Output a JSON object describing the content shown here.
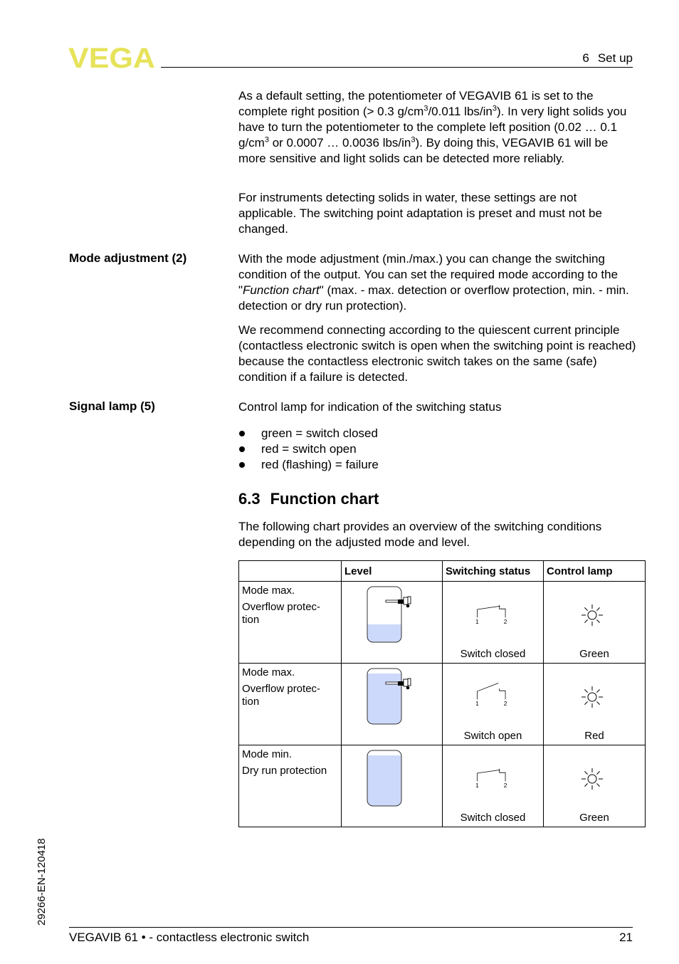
{
  "header": {
    "logo_text": "VEGA",
    "logo_color": "#e6e35a",
    "section_number": "6",
    "section_title": "Set up"
  },
  "intro": {
    "p1": {
      "t1": "As a default setting, the potentiometer of VEGAVIB 61 is set to the complete right position (> 0.3 g/cm",
      "s1": "3",
      "t2": "/0.011 lbs/in",
      "s2": "3",
      "t3": "). In very light solids you have to turn the potentiometer to the complete left position (0.02 … 0.1 g/cm",
      "s3": "3",
      "t4": " or 0.0007 … 0.0036 lbs/in",
      "s4": "3",
      "t5": "). By doing this, VEGAVIB 61 will be more sensitive and light solids can be detected more reliably."
    },
    "p2": "For instruments detecting solids in water, these settings are not applicable. The switching point adaptation is preset and must not be changed."
  },
  "mode_adjustment": {
    "label": "Mode adjustment (2)",
    "p1_a": "With the mode adjustment (min./max.) you can change the switching condition of the output. You can set the required mode according to the \"",
    "p1_em": "Function chart",
    "p1_b": "\" (max. - max. detection or overflow protection, min. - min. detection or dry run protection).",
    "p2": "We recommend connecting according to the quiescent current principle (contactless electronic switch is open when the switching point is reached) because the contactless electronic switch takes on the same (safe) condition if a failure is detected."
  },
  "signal_lamp": {
    "label": "Signal lamp (5)",
    "text": "Control lamp for indication of the switching status",
    "bullets": [
      "green = switch closed",
      "red = switch open",
      "red (flashing) = failure"
    ]
  },
  "section": {
    "number": "6.3",
    "title": "Function chart",
    "intro": "The following chart provides an overview of the switching conditions depending on the adjusted mode and level."
  },
  "table": {
    "headers": [
      "",
      "Level",
      "Switching status",
      "Control lamp"
    ],
    "liquid_color": "#cdd9fa",
    "rows": [
      {
        "mode": "Mode max.",
        "description": "Overflow protec-tion",
        "desc_line1": "Overflow protec-",
        "desc_line2": "tion",
        "level": "low",
        "sensor_position": "top",
        "switch_state": "closed",
        "switch_label": "Switch closed",
        "terminal_1": "1",
        "terminal_2": "2",
        "lamp": "Green"
      },
      {
        "mode": "Mode max.",
        "description": "Overflow protec-tion",
        "desc_line1": "Overflow protec-",
        "desc_line2": "tion",
        "level": "high",
        "sensor_position": "top",
        "switch_state": "open",
        "switch_label": "Switch open",
        "terminal_1": "1",
        "terminal_2": "2",
        "lamp": "Red"
      },
      {
        "mode": "Mode min.",
        "description": "Dry run protection",
        "desc_line1": "Dry run protection",
        "desc_line2": "",
        "level": "high",
        "sensor_position": "bottom",
        "switch_state": "closed",
        "switch_label": "Switch closed",
        "terminal_1": "1",
        "terminal_2": "2",
        "lamp": "Green"
      }
    ]
  },
  "footer": {
    "title": "VEGAVIB 61 • - contactless electronic switch",
    "page": "21",
    "doc_id": "29266-EN-120418"
  }
}
